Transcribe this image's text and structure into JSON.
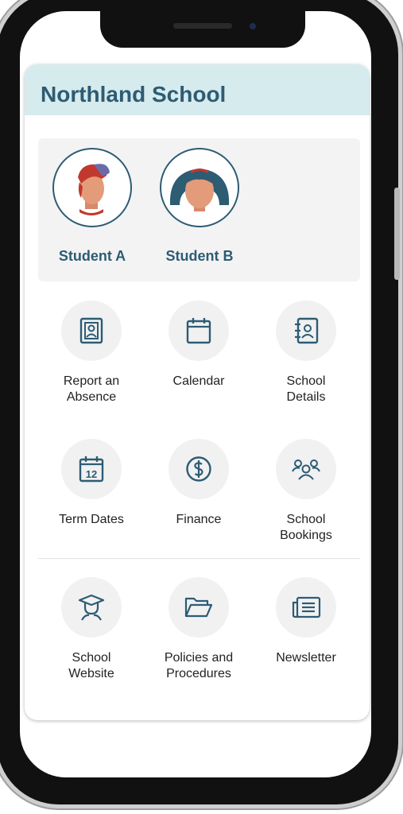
{
  "app": {
    "school_name": "Northland School"
  },
  "students": [
    {
      "name": "Student A",
      "avatar": "boy-with-cap-avatar"
    },
    {
      "name": "Student B",
      "avatar": "girl-with-headband-avatar"
    }
  ],
  "tiles": [
    {
      "label": "Report an\nAbsence",
      "icon": "id-badge-icon"
    },
    {
      "label": "Calendar",
      "icon": "calendar-icon"
    },
    {
      "label": "School\nDetails",
      "icon": "contact-book-icon"
    },
    {
      "label": "Term Dates",
      "icon": "calendar-date-icon",
      "number": "12"
    },
    {
      "label": "Finance",
      "icon": "dollar-coin-icon"
    },
    {
      "label": "School\nBookings",
      "icon": "group-icon"
    },
    {
      "label": "School\nWebsite",
      "icon": "graduate-icon"
    },
    {
      "label": "Policies and\nProcedures",
      "icon": "folder-open-icon"
    },
    {
      "label": "Newsletter",
      "icon": "newspaper-icon"
    }
  ],
  "colors": {
    "accent": "#2d5c73",
    "header_bg": "#d6ebee",
    "panel_bg": "#f3f3f4",
    "tile_bg": "#f1f1f2"
  }
}
